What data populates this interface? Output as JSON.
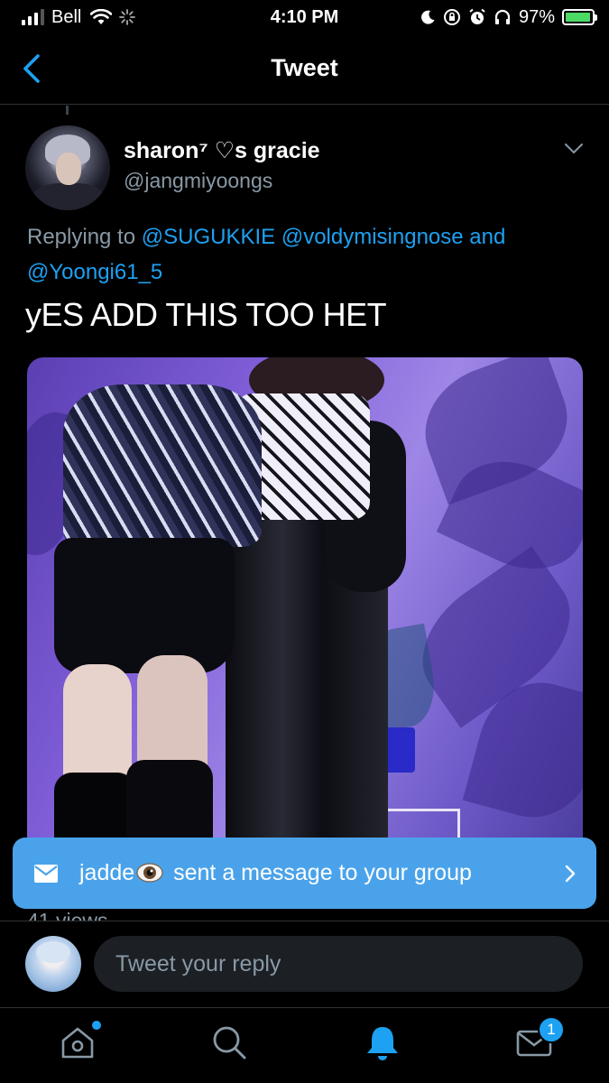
{
  "status_bar": {
    "carrier": "Bell",
    "time": "4:10 PM",
    "battery_percent": "97%",
    "battery_level": 0.97,
    "signal_bars": 3
  },
  "header": {
    "back_icon": "chevron-left-icon",
    "title": "Tweet"
  },
  "tweet": {
    "author": {
      "display_name": "sharon⁷",
      "display_name_heart": "♡",
      "display_name_suffix": "s gracie",
      "handle": "@jangmiyoongs"
    },
    "replying_prefix": "Replying to",
    "replying_mentions": [
      "@SUGUKKIE",
      "@voldymisingnose"
    ],
    "replying_and": "and",
    "replying_last": "@Yoongi61_5",
    "text": "yES ADD THIS TOO HET",
    "views": "41 views"
  },
  "toast": {
    "sender": "jadde",
    "message": "sent a message to your group"
  },
  "reply": {
    "placeholder": "Tweet your reply"
  },
  "tab_bar": {
    "items": [
      {
        "name": "home",
        "icon": "home-icon",
        "has_dot": true
      },
      {
        "name": "search",
        "icon": "search-icon"
      },
      {
        "name": "notifications",
        "icon": "bell-icon",
        "active": true
      },
      {
        "name": "messages",
        "icon": "mail-icon",
        "badge": "1"
      }
    ]
  },
  "colors": {
    "background": "#000000",
    "accent": "#1da1f2",
    "secondary_text": "#8899a6",
    "toast": "#4aa3ea",
    "battery": "#4cd964"
  }
}
